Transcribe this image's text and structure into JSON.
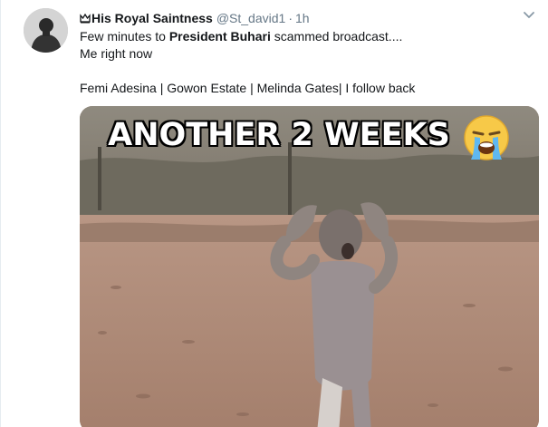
{
  "tweet": {
    "display_name": "His Royal Saintness",
    "handle": "@St_david1",
    "separator": "·",
    "time": "1h",
    "line1_before": "Few minutes to ",
    "line1_bold": "President Buhari",
    "line1_after": " scammed broadcast....",
    "line2": "Me right now",
    "line3": "Femi Adesina | Gowon Estate | Melinda Gates| I follow back"
  },
  "media": {
    "caption": "ANOTHER 2 WEEKS",
    "emoji": "loudly-crying-face"
  },
  "icons": {
    "crown": "crown-icon",
    "caret": "chevron-down-icon"
  },
  "colors": {
    "text": "#14171a",
    "muted": "#657786",
    "caret": "#8899a6"
  }
}
